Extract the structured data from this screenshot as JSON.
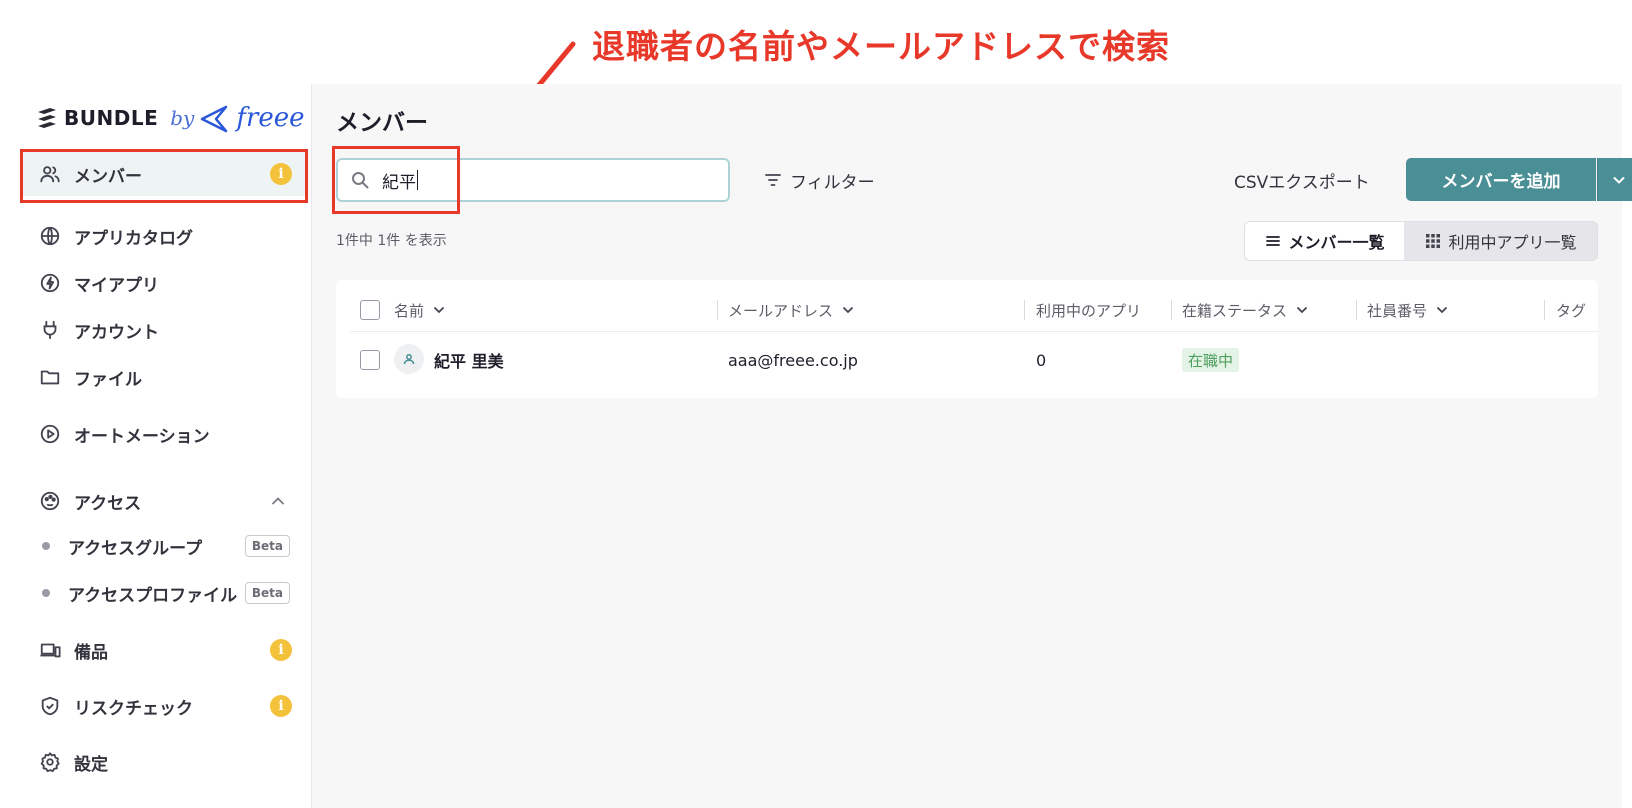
{
  "annotation": {
    "text": "退職者の名前やメールアドレスで検索"
  },
  "logo": {
    "word": "BUNDLE",
    "by": "by",
    "freee": "freee"
  },
  "sidebar": {
    "items": [
      {
        "label": "メンバー",
        "icon": "users-icon"
      },
      {
        "label": "アプリカタログ",
        "icon": "globe-icon"
      },
      {
        "label": "マイアプリ",
        "icon": "bolt-icon"
      },
      {
        "label": "アカウント",
        "icon": "plug-icon"
      },
      {
        "label": "ファイル",
        "icon": "folder-icon"
      },
      {
        "label": "オートメーション",
        "icon": "play-icon"
      },
      {
        "label": "アクセス",
        "icon": "palette-icon"
      },
      {
        "label": "備品",
        "icon": "devices-icon"
      },
      {
        "label": "リスクチェック",
        "icon": "shield-icon"
      },
      {
        "label": "設定",
        "icon": "gear-icon"
      }
    ],
    "sub_items": [
      {
        "label": "アクセスグループ",
        "badge": "Beta"
      },
      {
        "label": "アクセスプロファイル",
        "badge": "Beta"
      }
    ],
    "info_badge": "i"
  },
  "header": {
    "title": "メンバー",
    "search_value": "紀平",
    "filter_label": "フィルター",
    "csv_label": "CSVエクスポート",
    "add_label": "メンバーを追加"
  },
  "count_text": "1件中 1件 を表示",
  "view_toggle": {
    "list_label": "メンバー一覧",
    "apps_label": "利用中アプリ一覧"
  },
  "table": {
    "columns": [
      "名前",
      "メールアドレス",
      "利用中のアプリ",
      "在籍ステータス",
      "社員番号",
      "タグ"
    ],
    "rows": [
      {
        "name": "紀平 里美",
        "email": "aaa@freee.co.jp",
        "apps": "0",
        "status": "在職中"
      }
    ]
  },
  "colors": {
    "accent": "#4a8f96",
    "highlight": "#e8382a",
    "info": "#f4c23a",
    "status_bg": "#e3f3e6",
    "status_fg": "#4c9f5c"
  }
}
